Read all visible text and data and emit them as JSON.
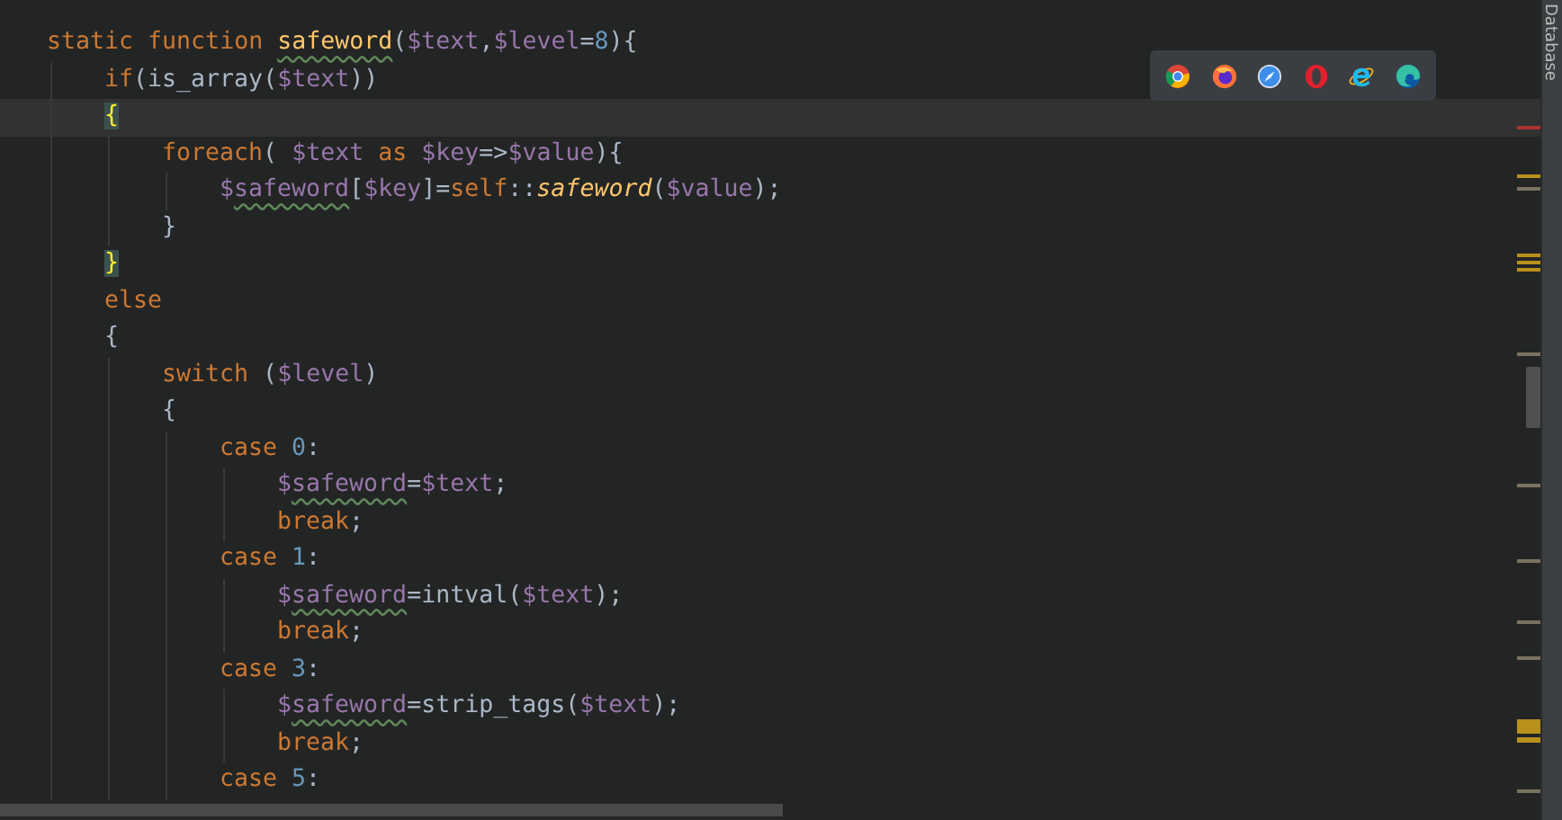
{
  "editor": {
    "lines": [
      {
        "current": false,
        "tokens": [
          {
            "kind": "kw",
            "text": "static function "
          },
          {
            "kind": "fn-typo",
            "text": "safeword"
          },
          {
            "kind": "text",
            "text": "("
          },
          {
            "kind": "var",
            "text": "$text"
          },
          {
            "kind": "text",
            "text": ","
          },
          {
            "kind": "var",
            "text": "$level"
          },
          {
            "kind": "text",
            "text": "="
          },
          {
            "kind": "num",
            "text": "8"
          },
          {
            "kind": "text",
            "text": "){"
          }
        ],
        "children": [
          {
            "current": false,
            "tokens": [
              {
                "kind": "kw",
                "text": "if"
              },
              {
                "kind": "text",
                "text": "(is_array("
              },
              {
                "kind": "var",
                "text": "$text"
              },
              {
                "kind": "text",
                "text": "))"
              }
            ]
          },
          {
            "current": true,
            "tokens": [
              {
                "kind": "match",
                "text": "{"
              }
            ],
            "children": [
              {
                "current": false,
                "tokens": [
                  {
                    "kind": "kw",
                    "text": "foreach"
                  },
                  {
                    "kind": "text",
                    "text": "( "
                  },
                  {
                    "kind": "var",
                    "text": "$text "
                  },
                  {
                    "kind": "kw",
                    "text": "as "
                  },
                  {
                    "kind": "var",
                    "text": "$key"
                  },
                  {
                    "kind": "text",
                    "text": "=>"
                  },
                  {
                    "kind": "var",
                    "text": "$value"
                  },
                  {
                    "kind": "text",
                    "text": "){"
                  }
                ],
                "children": [
                  {
                    "current": false,
                    "tokens": [
                      {
                        "kind": "var",
                        "text": "$"
                      },
                      {
                        "kind": "var-typo",
                        "text": "safeword"
                      },
                      {
                        "kind": "text",
                        "text": "["
                      },
                      {
                        "kind": "var",
                        "text": "$key"
                      },
                      {
                        "kind": "text",
                        "text": "]="
                      },
                      {
                        "kind": "kw",
                        "text": "self"
                      },
                      {
                        "kind": "text",
                        "text": "::"
                      },
                      {
                        "kind": "call",
                        "text": "safeword"
                      },
                      {
                        "kind": "text",
                        "text": "("
                      },
                      {
                        "kind": "var",
                        "text": "$value"
                      },
                      {
                        "kind": "text",
                        "text": ");"
                      }
                    ]
                  }
                ]
              },
              {
                "current": false,
                "tokens": [
                  {
                    "kind": "text",
                    "text": "}"
                  }
                ]
              }
            ]
          },
          {
            "current": false,
            "tokens": [
              {
                "kind": "match",
                "text": "}"
              }
            ]
          },
          {
            "current": false,
            "tokens": [
              {
                "kind": "kw",
                "text": "else"
              }
            ]
          },
          {
            "current": false,
            "tokens": [
              {
                "kind": "text",
                "text": "{"
              }
            ],
            "children": [
              {
                "current": false,
                "tokens": [
                  {
                    "kind": "kw",
                    "text": "switch "
                  },
                  {
                    "kind": "text",
                    "text": "("
                  },
                  {
                    "kind": "var",
                    "text": "$level"
                  },
                  {
                    "kind": "text",
                    "text": ")"
                  }
                ]
              },
              {
                "current": false,
                "tokens": [
                  {
                    "kind": "text",
                    "text": "{"
                  }
                ],
                "children": [
                  {
                    "current": false,
                    "tokens": [
                      {
                        "kind": "kw",
                        "text": "case "
                      },
                      {
                        "kind": "num",
                        "text": "0"
                      },
                      {
                        "kind": "text",
                        "text": ":"
                      }
                    ],
                    "children": [
                      {
                        "current": false,
                        "tokens": [
                          {
                            "kind": "var",
                            "text": "$"
                          },
                          {
                            "kind": "var-typo",
                            "text": "safeword"
                          },
                          {
                            "kind": "text",
                            "text": "="
                          },
                          {
                            "kind": "var",
                            "text": "$text"
                          },
                          {
                            "kind": "text",
                            "text": ";"
                          }
                        ]
                      },
                      {
                        "current": false,
                        "tokens": [
                          {
                            "kind": "kw",
                            "text": "break"
                          },
                          {
                            "kind": "text",
                            "text": ";"
                          }
                        ]
                      }
                    ]
                  },
                  {
                    "current": false,
                    "tokens": [
                      {
                        "kind": "kw",
                        "text": "case "
                      },
                      {
                        "kind": "num",
                        "text": "1"
                      },
                      {
                        "kind": "text",
                        "text": ":"
                      }
                    ],
                    "children": [
                      {
                        "current": false,
                        "tokens": [
                          {
                            "kind": "var",
                            "text": "$"
                          },
                          {
                            "kind": "var-typo",
                            "text": "safeword"
                          },
                          {
                            "kind": "text",
                            "text": "=intval("
                          },
                          {
                            "kind": "var",
                            "text": "$text"
                          },
                          {
                            "kind": "text",
                            "text": ");"
                          }
                        ]
                      },
                      {
                        "current": false,
                        "tokens": [
                          {
                            "kind": "kw",
                            "text": "break"
                          },
                          {
                            "kind": "text",
                            "text": ";"
                          }
                        ]
                      }
                    ]
                  },
                  {
                    "current": false,
                    "tokens": [
                      {
                        "kind": "kw",
                        "text": "case "
                      },
                      {
                        "kind": "num",
                        "text": "3"
                      },
                      {
                        "kind": "text",
                        "text": ":"
                      }
                    ],
                    "children": [
                      {
                        "current": false,
                        "tokens": [
                          {
                            "kind": "var",
                            "text": "$"
                          },
                          {
                            "kind": "var-typo",
                            "text": "safeword"
                          },
                          {
                            "kind": "text",
                            "text": "=strip_tags("
                          },
                          {
                            "kind": "var",
                            "text": "$text"
                          },
                          {
                            "kind": "text",
                            "text": ");"
                          }
                        ]
                      },
                      {
                        "current": false,
                        "tokens": [
                          {
                            "kind": "kw",
                            "text": "break"
                          },
                          {
                            "kind": "text",
                            "text": ";"
                          }
                        ]
                      }
                    ]
                  },
                  {
                    "current": false,
                    "tokens": [
                      {
                        "kind": "kw",
                        "text": "case "
                      },
                      {
                        "kind": "num",
                        "text": "5"
                      },
                      {
                        "kind": "text",
                        "text": ":"
                      }
                    ]
                  }
                ]
              }
            ]
          }
        ]
      }
    ]
  },
  "browser_bar": {
    "browsers": [
      {
        "kind": "chrome"
      },
      {
        "kind": "firefox"
      },
      {
        "kind": "safari"
      },
      {
        "kind": "opera"
      },
      {
        "kind": "ie"
      },
      {
        "kind": "edge"
      }
    ]
  },
  "side_panel": {
    "label": "Database"
  }
}
